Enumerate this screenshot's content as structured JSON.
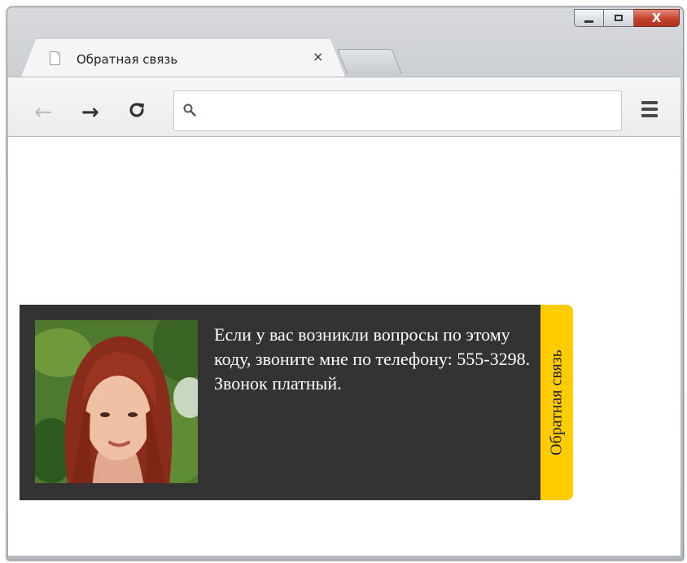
{
  "browser": {
    "tab": {
      "title": "Обратная связь",
      "close_glyph": "×",
      "icon": "document-icon"
    },
    "window_controls": {
      "minimize": "minimize-icon",
      "maximize": "maximize-icon",
      "close": "close-icon"
    },
    "toolbar": {
      "back_glyph": "←",
      "forward_glyph": "→",
      "reload_glyph": "↻",
      "address_value": "",
      "address_placeholder": ""
    }
  },
  "page": {
    "feedback": {
      "text": "Если у вас возникли вопросы по этому коду, звоните мне по телефону: 555-3298. Звонок платный.",
      "tab_label": "Обратная связь",
      "panel_color": "#333333",
      "tab_color": "#ffcc00"
    }
  }
}
